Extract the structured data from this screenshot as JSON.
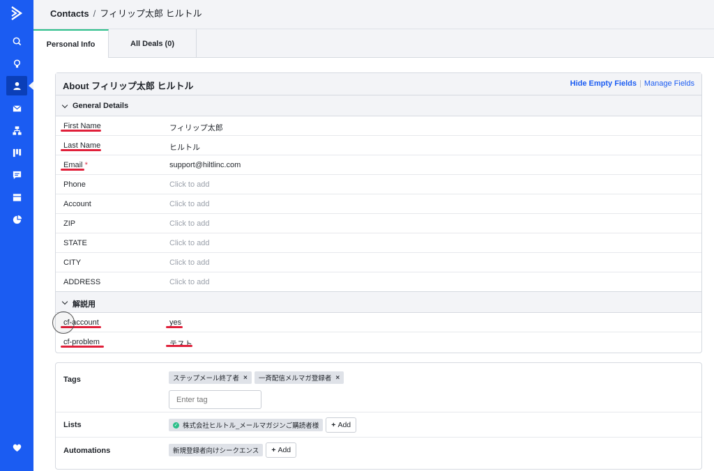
{
  "breadcrumb": {
    "root": "Contacts",
    "separator": "/",
    "current": "フィリップ太郎 ヒルトル"
  },
  "tabs": [
    {
      "label": "Personal Info",
      "active": true
    },
    {
      "label": "All Deals (0)",
      "active": false
    }
  ],
  "sidebar": {
    "items": [
      {
        "icon": "search-icon"
      },
      {
        "icon": "lightbulb-icon"
      },
      {
        "icon": "contacts-icon",
        "active": true
      },
      {
        "icon": "mail-icon"
      },
      {
        "icon": "automation-icon"
      },
      {
        "icon": "pipeline-icon"
      },
      {
        "icon": "conversations-icon"
      },
      {
        "icon": "site-icon"
      },
      {
        "icon": "reports-icon"
      }
    ],
    "bottom_icon": "heart-icon"
  },
  "about": {
    "title": "About フィリップ太郎 ヒルトル",
    "hide_empty": "Hide Empty Fields",
    "link_sep": "|",
    "manage_fields": "Manage Fields"
  },
  "general": {
    "title": "General Details",
    "fields": [
      {
        "label": "First Name",
        "value": "フィリップ太郎"
      },
      {
        "label": "Last Name",
        "value": "ヒルトル"
      },
      {
        "label": "Email",
        "required": "*",
        "value": "support@hiltlinc.com"
      },
      {
        "label": "Phone",
        "value": "Click to add"
      },
      {
        "label": "Account",
        "value": "Click to add"
      },
      {
        "label": "ZIP",
        "value": "Click to add"
      },
      {
        "label": "STATE",
        "value": "Click to add"
      },
      {
        "label": "CITY",
        "value": "Click to add"
      },
      {
        "label": "ADDRESS",
        "value": "Click to add"
      }
    ]
  },
  "custom": {
    "title": "解説用",
    "fields": [
      {
        "label": "cf-account",
        "value": "yes"
      },
      {
        "label": "cf-problem",
        "value": "テスト"
      }
    ]
  },
  "tags": {
    "label": "Tags",
    "items": [
      "ステップメール終了者",
      "一斉配信メルマガ登録者"
    ],
    "remove": "×",
    "input_placeholder": "Enter tag"
  },
  "lists": {
    "label": "Lists",
    "items": [
      "株式会社ヒルトル_メールマガジンご購読者様"
    ],
    "add": "Add"
  },
  "automations": {
    "label": "Automations",
    "items": [
      "新規登録者向けシークエンス"
    ],
    "add": "Add"
  },
  "colors": {
    "sidebar": "#1b5cf2",
    "accent_tab": "#2bbf8a",
    "link": "#1b5cf2",
    "annotation_underline": "#e0203a"
  }
}
